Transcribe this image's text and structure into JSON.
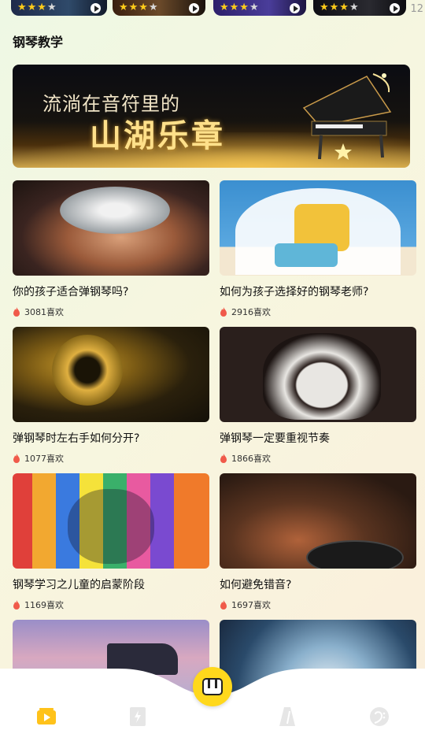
{
  "top_cards": [
    {
      "rating": 3
    },
    {
      "rating": 3
    },
    {
      "rating": 3
    },
    {
      "rating": 3
    }
  ],
  "status_clock": "12",
  "section": {
    "title": "钢琴教学"
  },
  "banner": {
    "line1": "流淌在音符里的",
    "line2": "山湖乐章"
  },
  "articles": [
    {
      "title": "你的孩子适合弹钢琴吗?",
      "likes": "3081喜欢"
    },
    {
      "title": "如何为孩子选择好的钢琴老师?",
      "likes": "2916喜欢"
    },
    {
      "title": "弹钢琴时左右手如何分开?",
      "likes": "1077喜欢"
    },
    {
      "title": "弹钢琴一定要重视节奏",
      "likes": "1866喜欢"
    },
    {
      "title": "钢琴学习之儿童的启蒙阶段",
      "likes": "1169喜欢"
    },
    {
      "title": "如何避免错音?",
      "likes": "1697喜欢"
    }
  ],
  "nav": {
    "items": [
      "video-icon",
      "book-icon",
      "piano-icon",
      "metronome-icon",
      "bass-clef-icon"
    ],
    "accent": "#ffd81c"
  },
  "colors": {
    "flame": "#f05a4a",
    "star": "#ffcc1a"
  }
}
